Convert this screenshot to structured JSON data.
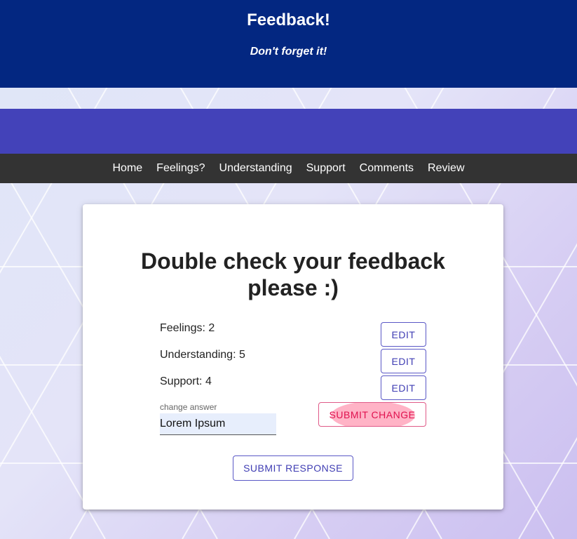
{
  "header": {
    "title": "Feedback!",
    "subtitle": "Don't forget it!"
  },
  "nav": {
    "items": [
      "Home",
      "Feelings?",
      "Understanding",
      "Support",
      "Comments",
      "Review"
    ]
  },
  "review": {
    "heading": "Double check your feedback please :)",
    "answers": [
      {
        "label": "Feelings:",
        "value": "2",
        "edit_label": "EDIT"
      },
      {
        "label": "Understanding:",
        "value": "5",
        "edit_label": "EDIT"
      },
      {
        "label": "Support:",
        "value": "4",
        "edit_label": "EDIT"
      }
    ],
    "change_field": {
      "label": "change answer",
      "value": "Lorem Ipsum"
    },
    "submit_change_label": "SUBMIT CHANGE",
    "submit_response_label": "SUBMIT RESPONSE"
  },
  "colors": {
    "header_bg": "#032781",
    "band_bg": "#4342b9",
    "nav_bg": "#333333",
    "accent": "#3f3db3",
    "submit_change_accent": "#e0114f"
  }
}
